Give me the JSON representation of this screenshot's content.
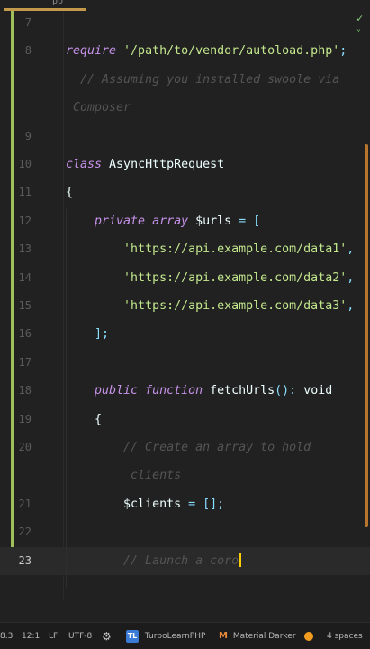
{
  "editor": {
    "tab_fragment": "pp",
    "lines": [
      {
        "number": "7",
        "tokens": []
      },
      {
        "number": "8",
        "tokens": [
          {
            "t": "require ",
            "c": "kw"
          },
          {
            "t": "'/path/to/vendor/autoload.php'",
            "c": "str"
          },
          {
            "t": ";",
            "c": "punct"
          }
        ]
      },
      {
        "number": "",
        "tokens": [
          {
            "t": "  // Assuming you installed swoole via",
            "c": "cmt"
          }
        ]
      },
      {
        "number": "",
        "tokens": [
          {
            "t": " Composer",
            "c": "cmt"
          }
        ]
      },
      {
        "number": "9",
        "tokens": []
      },
      {
        "number": "10",
        "tokens": [
          {
            "t": "class ",
            "c": "kw"
          },
          {
            "t": "AsyncHttpRequest",
            "c": "white"
          }
        ]
      },
      {
        "number": "11",
        "tokens": [
          {
            "t": "{",
            "c": "white"
          }
        ]
      },
      {
        "number": "12",
        "tokens": [
          {
            "t": "    private array ",
            "c": "kw"
          },
          {
            "t": "$urls",
            "c": "var"
          },
          {
            "t": " = [",
            "c": "punct"
          }
        ]
      },
      {
        "number": "13",
        "tokens": [
          {
            "t": "        'https://api.example.com/data1'",
            "c": "str"
          },
          {
            "t": ",",
            "c": "punct"
          }
        ]
      },
      {
        "number": "14",
        "tokens": [
          {
            "t": "        'https://api.example.com/data2'",
            "c": "str"
          },
          {
            "t": ",",
            "c": "punct"
          }
        ]
      },
      {
        "number": "15",
        "tokens": [
          {
            "t": "        'https://api.example.com/data3'",
            "c": "str"
          },
          {
            "t": ",",
            "c": "punct"
          }
        ]
      },
      {
        "number": "16",
        "tokens": [
          {
            "t": "    ];",
            "c": "punct"
          }
        ]
      },
      {
        "number": "17",
        "tokens": []
      },
      {
        "number": "18",
        "tokens": [
          {
            "t": "    public function ",
            "c": "kw"
          },
          {
            "t": "fetchUrls",
            "c": "white"
          },
          {
            "t": "(): ",
            "c": "punct"
          },
          {
            "t": "void",
            "c": "white"
          }
        ]
      },
      {
        "number": "19",
        "tokens": [
          {
            "t": "    {",
            "c": "white"
          }
        ]
      },
      {
        "number": "20",
        "tokens": [
          {
            "t": "        // Create an array to hold",
            "c": "cmt"
          }
        ]
      },
      {
        "number": "",
        "tokens": [
          {
            "t": "         clients",
            "c": "cmt"
          }
        ]
      },
      {
        "number": "21",
        "tokens": [
          {
            "t": "        $clients",
            "c": "var"
          },
          {
            "t": " = [];",
            "c": "punct"
          }
        ]
      },
      {
        "number": "22",
        "tokens": []
      },
      {
        "number": "23",
        "current": true,
        "cursor": true,
        "tokens": [
          {
            "t": "        // Launch a coro",
            "c": "cmt"
          }
        ]
      }
    ]
  },
  "status_bar": {
    "php_version": "8.3",
    "position": "12:1",
    "line_ending": "LF",
    "encoding": "UTF-8",
    "gear_icon": "gear-icon",
    "plugin_badge": "TL",
    "plugin_name": "TurboLearnPHP",
    "theme_icon": "M",
    "theme_name": "Material Darker",
    "indent": "4 spaces"
  },
  "colors": {
    "background": "#212121",
    "keyword": "#c792ea",
    "string": "#c3e88d",
    "comment": "#545454",
    "change_marker": "#9fbf5a",
    "scroll_thumb": "#b8762c",
    "cursor": "#ffcc00"
  }
}
